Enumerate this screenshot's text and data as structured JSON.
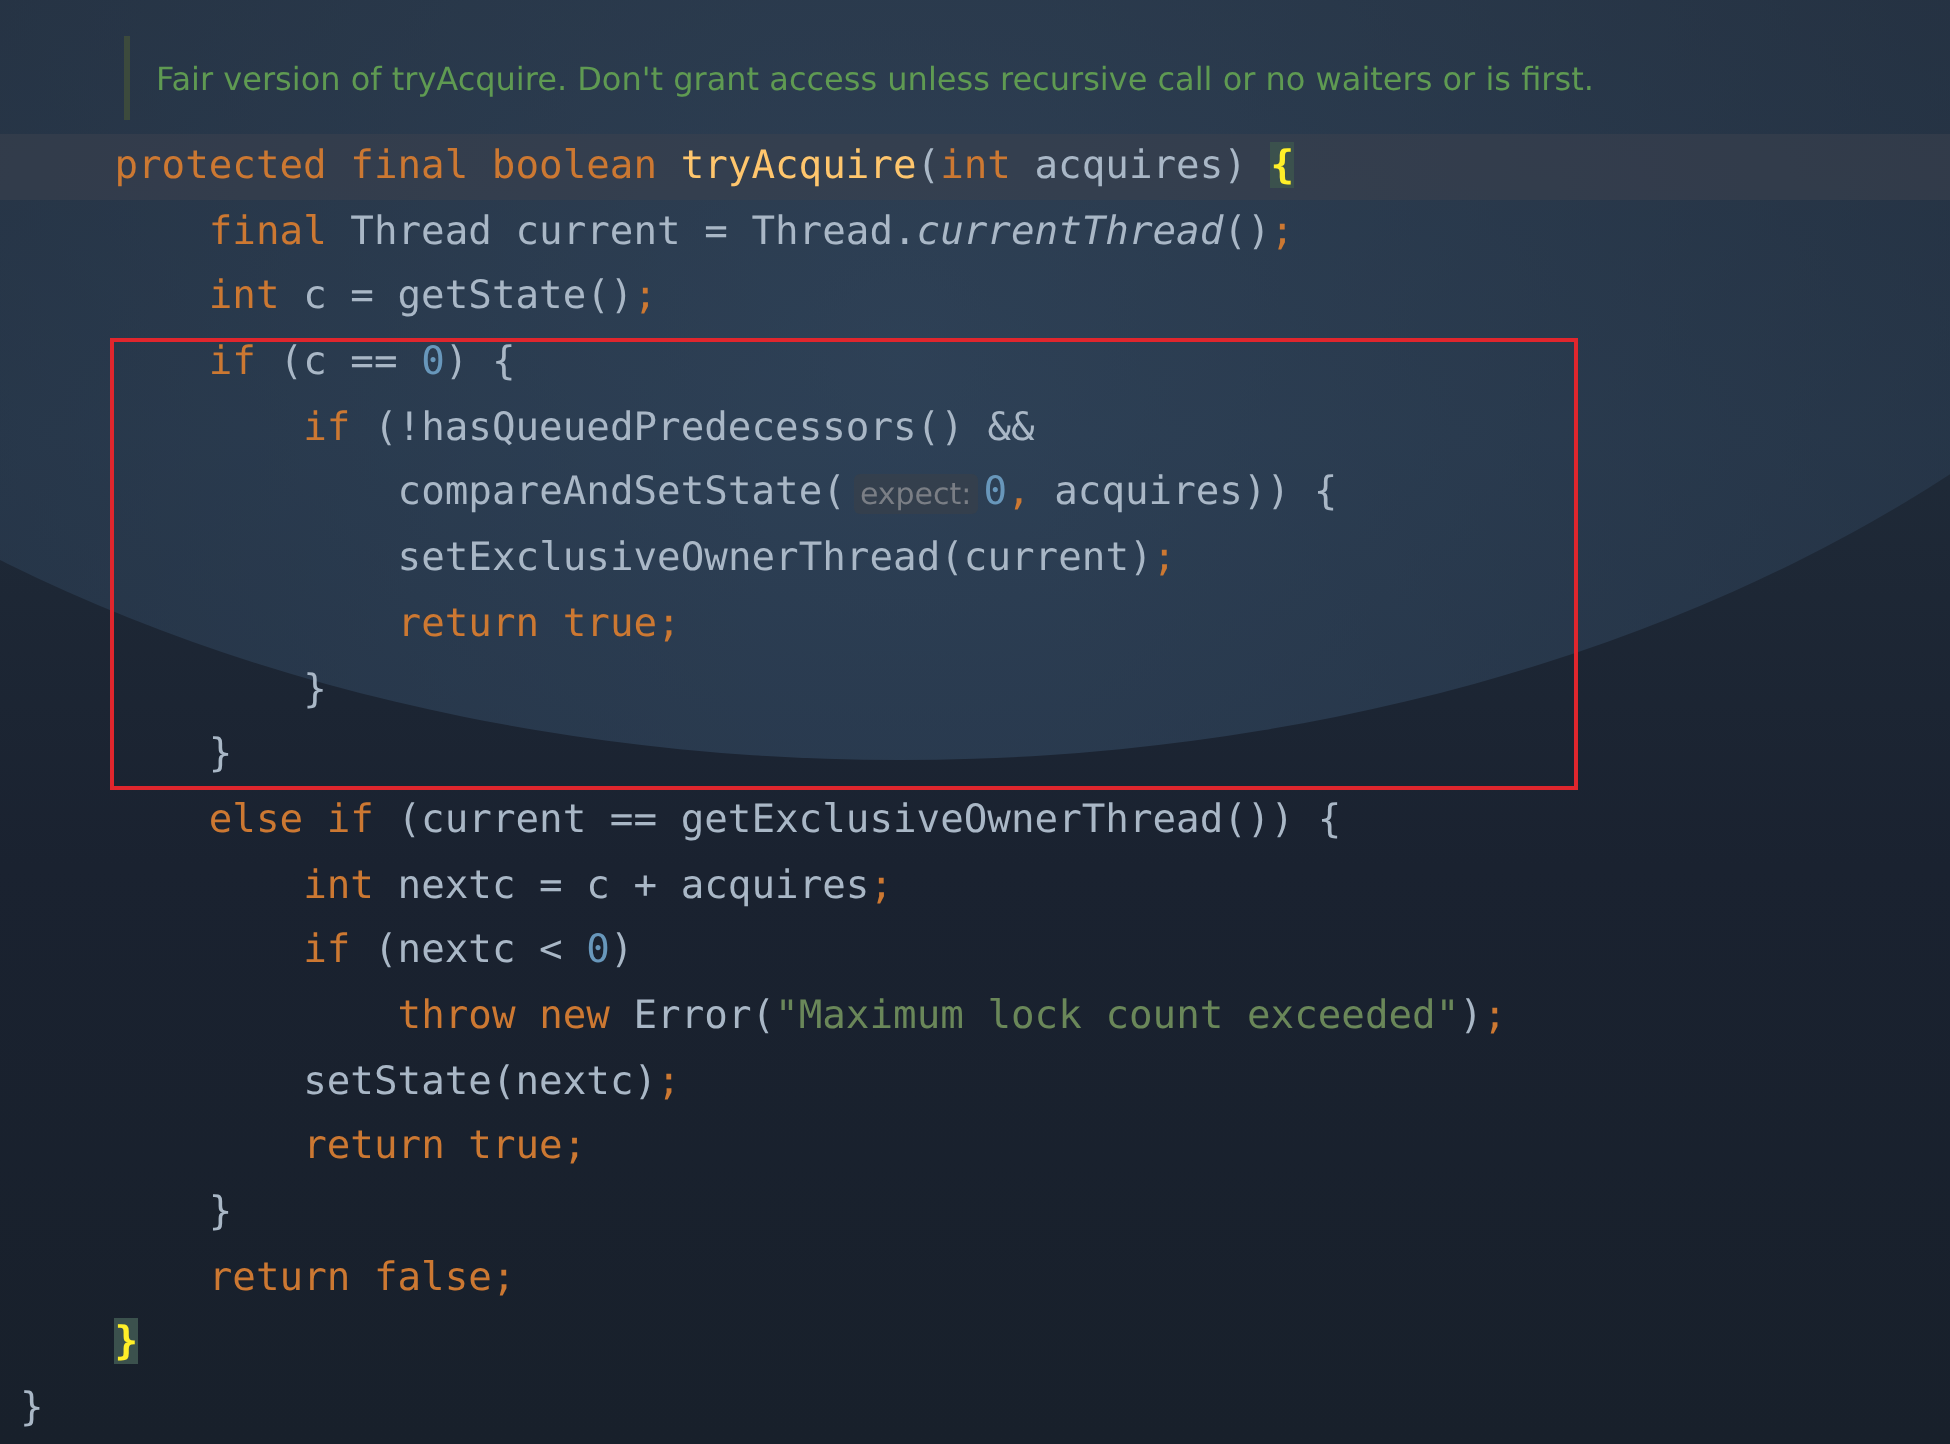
{
  "doc_comment": "Fair version of tryAcquire. Don't grant access unless recursive call or no waiters or is first.",
  "lines": [
    {
      "kind": "line",
      "current": true,
      "tokens": [
        {
          "kind": "keyword",
          "text": "protected final boolean "
        },
        {
          "kind": "declaration",
          "text": "tryAcquire"
        },
        {
          "kind": "plain",
          "text": "("
        },
        {
          "kind": "keyword",
          "text": "int"
        },
        {
          "kind": "plain",
          "text": " acquires) "
        },
        {
          "kind": "brace-match",
          "text": "{"
        }
      ],
      "children": [
        {
          "kind": "line",
          "current": false,
          "tokens": [
            {
              "kind": "keyword",
              "text": "final"
            },
            {
              "kind": "plain",
              "text": " Thread current = Thread."
            },
            {
              "kind": "static-call",
              "text": "currentThread"
            },
            {
              "kind": "plain",
              "text": "()"
            },
            {
              "kind": "keyword",
              "text": ";"
            }
          ]
        },
        {
          "kind": "line",
          "current": false,
          "tokens": [
            {
              "kind": "keyword",
              "text": "int"
            },
            {
              "kind": "plain",
              "text": " c = getState()"
            },
            {
              "kind": "keyword",
              "text": ";"
            }
          ]
        },
        {
          "kind": "highlight-box",
          "color": "#e0262d",
          "lines": [
            {
              "kind": "line",
              "current": false,
              "tokens": [
                {
                  "kind": "keyword",
                  "text": "if"
                },
                {
                  "kind": "plain",
                  "text": " (c == "
                },
                {
                  "kind": "number",
                  "text": "0"
                },
                {
                  "kind": "plain",
                  "text": ") {"
                }
              ],
              "children": [
                {
                  "kind": "line",
                  "current": false,
                  "tokens": [
                    {
                      "kind": "keyword",
                      "text": "if"
                    },
                    {
                      "kind": "plain",
                      "text": " (!hasQueuedPredecessors() &&"
                    }
                  ],
                  "children": [
                    {
                      "kind": "line",
                      "current": false,
                      "tokens": [
                        {
                          "kind": "plain",
                          "text": "compareAndSetState("
                        },
                        {
                          "kind": "hint",
                          "text": "expect:"
                        },
                        {
                          "kind": "number",
                          "text": "0"
                        },
                        {
                          "kind": "keyword",
                          "text": ","
                        },
                        {
                          "kind": "plain",
                          "text": " acquires)) {"
                        }
                      ]
                    },
                    {
                      "kind": "line",
                      "current": false,
                      "tokens": [
                        {
                          "kind": "plain",
                          "text": "setExclusiveOwnerThread(current)"
                        },
                        {
                          "kind": "keyword",
                          "text": ";"
                        }
                      ]
                    },
                    {
                      "kind": "line",
                      "current": false,
                      "tokens": [
                        {
                          "kind": "keyword",
                          "text": "return true;"
                        }
                      ]
                    }
                  ]
                },
                {
                  "kind": "line",
                  "current": false,
                  "tokens": [
                    {
                      "kind": "plain",
                      "text": "}"
                    }
                  ]
                }
              ]
            },
            {
              "kind": "line",
              "current": false,
              "tokens": [
                {
                  "kind": "plain",
                  "text": "}"
                }
              ]
            }
          ]
        },
        {
          "kind": "line",
          "current": false,
          "tokens": [
            {
              "kind": "keyword",
              "text": "else if"
            },
            {
              "kind": "plain",
              "text": " (current == getExclusiveOwnerThread()) {"
            }
          ],
          "children": [
            {
              "kind": "line",
              "current": false,
              "tokens": [
                {
                  "kind": "keyword",
                  "text": "int"
                },
                {
                  "kind": "plain",
                  "text": " nextc = c + acquires"
                },
                {
                  "kind": "keyword",
                  "text": ";"
                }
              ]
            },
            {
              "kind": "line",
              "current": false,
              "tokens": [
                {
                  "kind": "keyword",
                  "text": "if"
                },
                {
                  "kind": "plain",
                  "text": " (nextc < "
                },
                {
                  "kind": "number",
                  "text": "0"
                },
                {
                  "kind": "plain",
                  "text": ")"
                }
              ],
              "children": [
                {
                  "kind": "line",
                  "current": false,
                  "tokens": [
                    {
                      "kind": "keyword",
                      "text": "throw new"
                    },
                    {
                      "kind": "plain",
                      "text": " Error("
                    },
                    {
                      "kind": "string",
                      "text": "\"Maximum lock count exceeded\""
                    },
                    {
                      "kind": "plain",
                      "text": ")"
                    },
                    {
                      "kind": "keyword",
                      "text": ";"
                    }
                  ]
                }
              ]
            },
            {
              "kind": "line",
              "current": false,
              "tokens": [
                {
                  "kind": "plain",
                  "text": "setState(nextc)"
                },
                {
                  "kind": "keyword",
                  "text": ";"
                }
              ]
            },
            {
              "kind": "line",
              "current": false,
              "tokens": [
                {
                  "kind": "keyword",
                  "text": "return true;"
                }
              ]
            }
          ]
        },
        {
          "kind": "line",
          "current": false,
          "tokens": [
            {
              "kind": "plain",
              "text": "}"
            }
          ]
        },
        {
          "kind": "line",
          "current": false,
          "tokens": [
            {
              "kind": "keyword",
              "text": "return false;"
            }
          ]
        }
      ]
    },
    {
      "kind": "line",
      "current": false,
      "tokens": [
        {
          "kind": "brace-match",
          "text": "}"
        }
      ]
    }
  ],
  "class_close": {
    "current": false,
    "tokens": [
      {
        "kind": "plain",
        "text": "}"
      }
    ]
  }
}
